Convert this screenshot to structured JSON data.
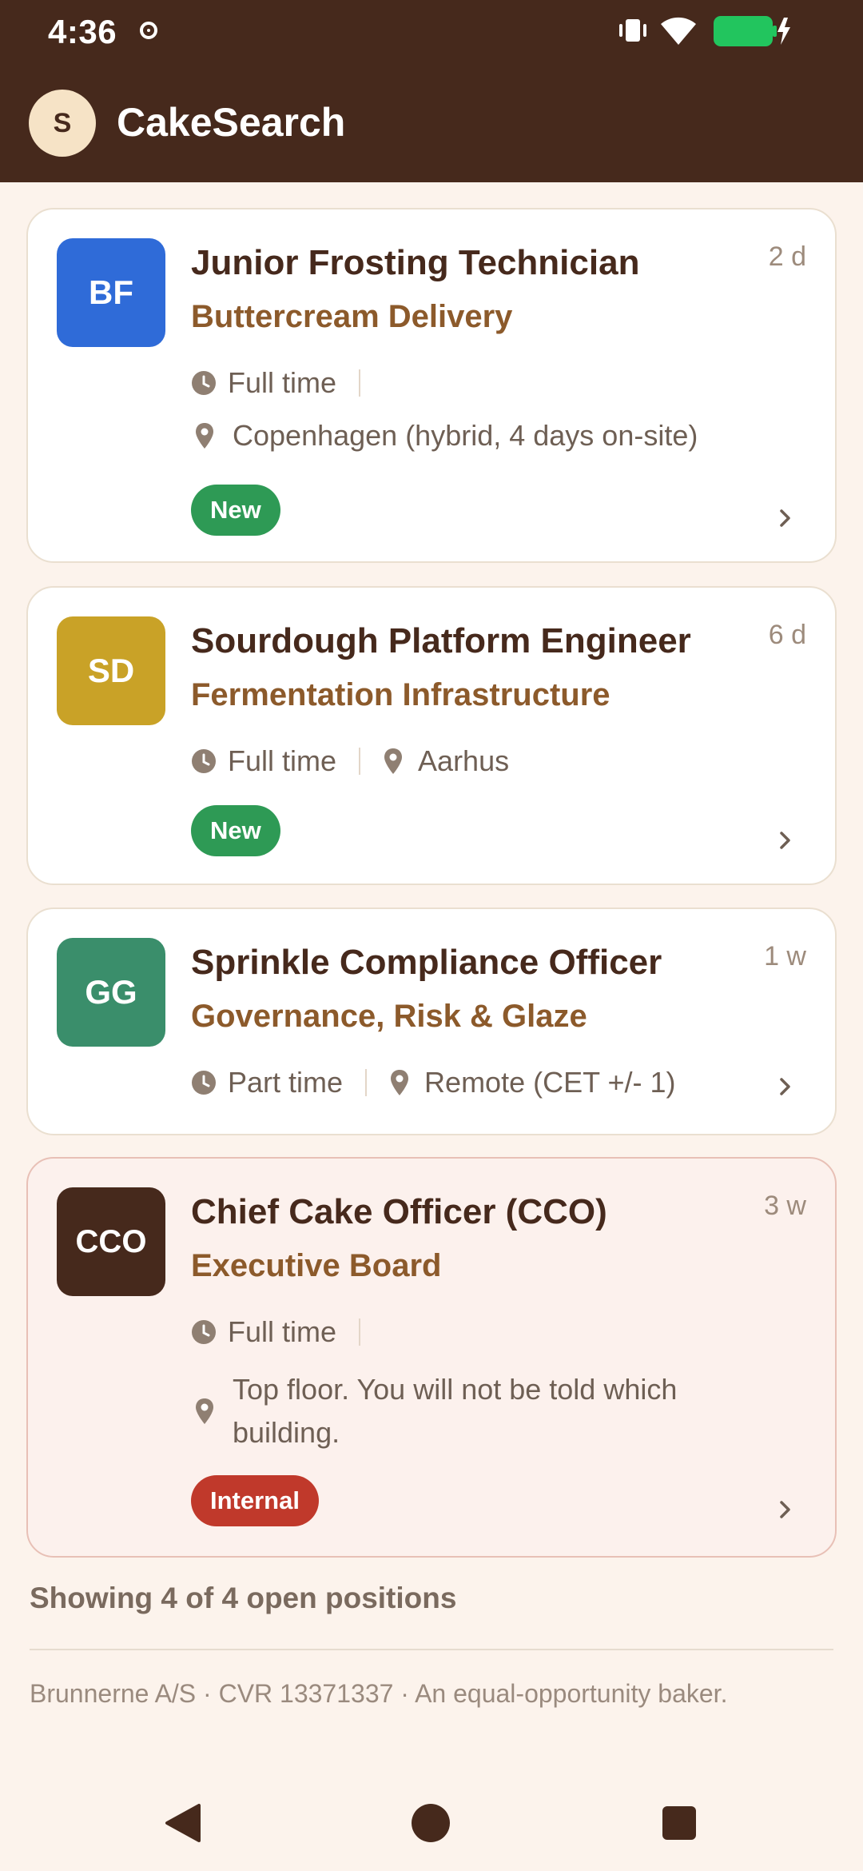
{
  "status_bar": {
    "time": "4:36"
  },
  "app_bar": {
    "avatar_initial": "S",
    "title": "CakeSearch"
  },
  "colors": {
    "header_bg": "#46291c",
    "accent_text": "#8c5a2b",
    "new_badge": "#2e9a55",
    "internal_badge": "#c0392b"
  },
  "jobs": [
    {
      "logo_text": "BF",
      "logo_color": "#2f6bd8",
      "title": "Junior Frosting Technician",
      "company": "Buttercream Delivery",
      "age": "2 d",
      "employment": "Full time",
      "location": "Copenhagen (hybrid, 4 days on-site)",
      "badge": "New"
    },
    {
      "logo_text": "SD",
      "logo_color": "#c9a227",
      "title": "Sourdough Platform Engineer",
      "company": "Fermentation Infrastructure",
      "age": "6 d",
      "employment": "Full time",
      "location": "Aarhus",
      "badge": "New"
    },
    {
      "logo_text": "GG",
      "logo_color": "#3a8e6b",
      "title": "Sprinkle Compliance Officer",
      "company": "Governance, Risk & Glaze",
      "age": "1 w",
      "employment": "Part time",
      "location": "Remote (CET +/- 1)",
      "badge": ""
    },
    {
      "logo_text": "CCO",
      "logo_color": "#46291c",
      "title": "Chief Cake Officer (CCO)",
      "company": "Executive Board",
      "age": "3 w",
      "employment": "Full time",
      "location": "Top floor. You will not be told which building.",
      "badge": "Internal"
    }
  ],
  "summary": "Showing 4 of 4 open positions",
  "footer": "Brunnerne A/S · CVR 13371337 · An equal-opportunity baker."
}
